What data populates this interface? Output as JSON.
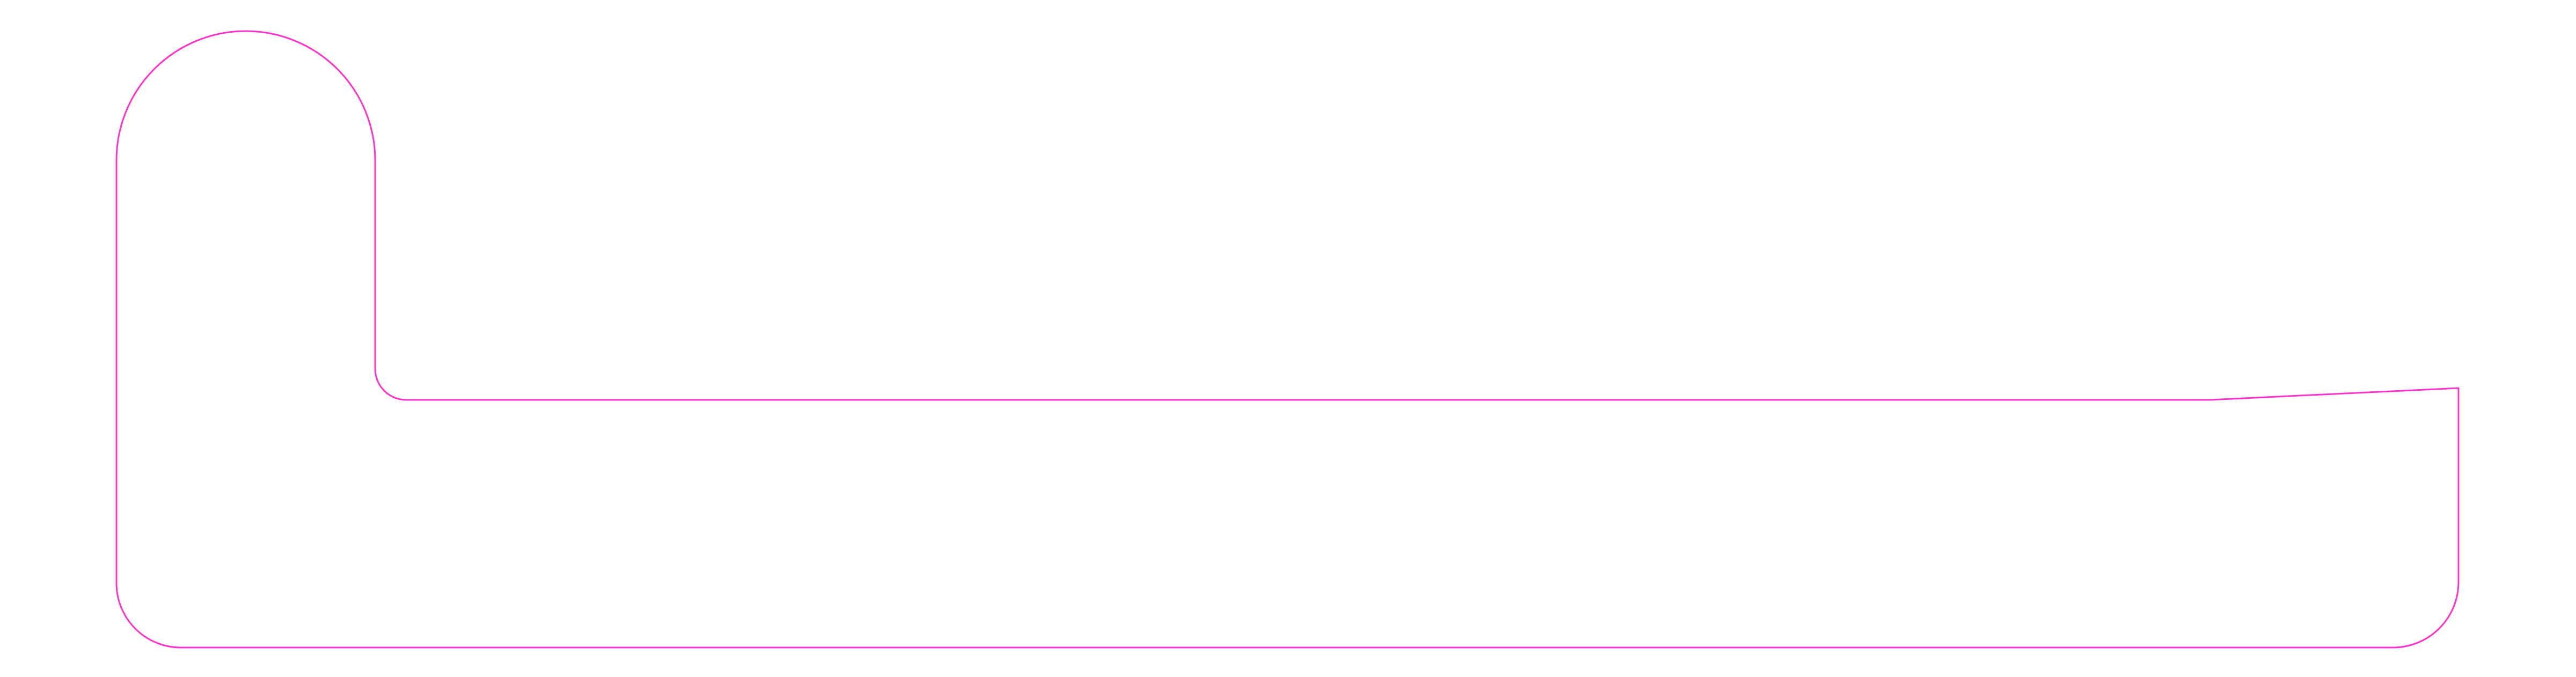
{
  "diagram": {
    "outline_color": "#ff33cc",
    "background_color": "#ffffff",
    "shape": "rounded-L-profile-outline"
  }
}
